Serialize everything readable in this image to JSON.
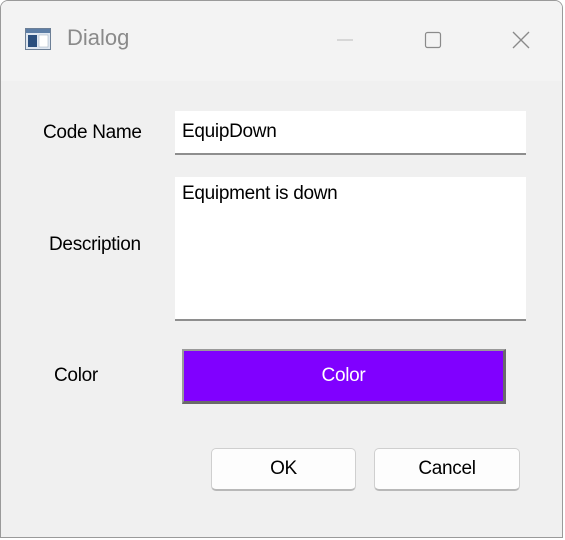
{
  "window": {
    "title": "Dialog",
    "app_icon": "window-app-icon",
    "controls": {
      "minimize_icon": "minimize-icon",
      "maximize_icon": "maximize-icon",
      "close_icon": "close-icon"
    }
  },
  "form": {
    "code_name_label": "Code Name",
    "code_name_value": "EquipDown",
    "description_label": "Description",
    "description_value": "Equipment is down",
    "color_label": "Color",
    "color_button_label": "Color",
    "selected_color": "#8000ff"
  },
  "buttons": {
    "ok_label": "OK",
    "cancel_label": "Cancel"
  }
}
